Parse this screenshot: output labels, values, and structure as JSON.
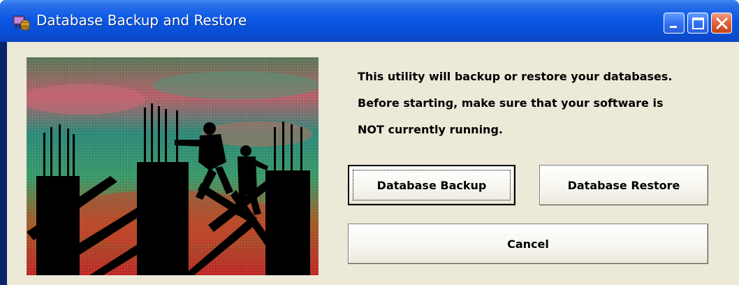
{
  "window": {
    "title": "Database Backup and Restore",
    "icons": {
      "app": "database-app-icon",
      "minimize": "minimize-icon",
      "maximize": "maximize-icon",
      "close": "close-icon"
    }
  },
  "content": {
    "picture": "construction-workers-silhouette-image",
    "message_lines": [
      "This utility will backup or restore your databases.",
      "Before starting, make sure that your software is",
      "NOT currently running."
    ]
  },
  "buttons": {
    "backup_label": "Database Backup",
    "restore_label": "Database Restore",
    "cancel_label": "Cancel"
  },
  "colors": {
    "titlebar": "#0a58e4",
    "client_background": "#ece9d8",
    "close_button": "#e2643f"
  }
}
